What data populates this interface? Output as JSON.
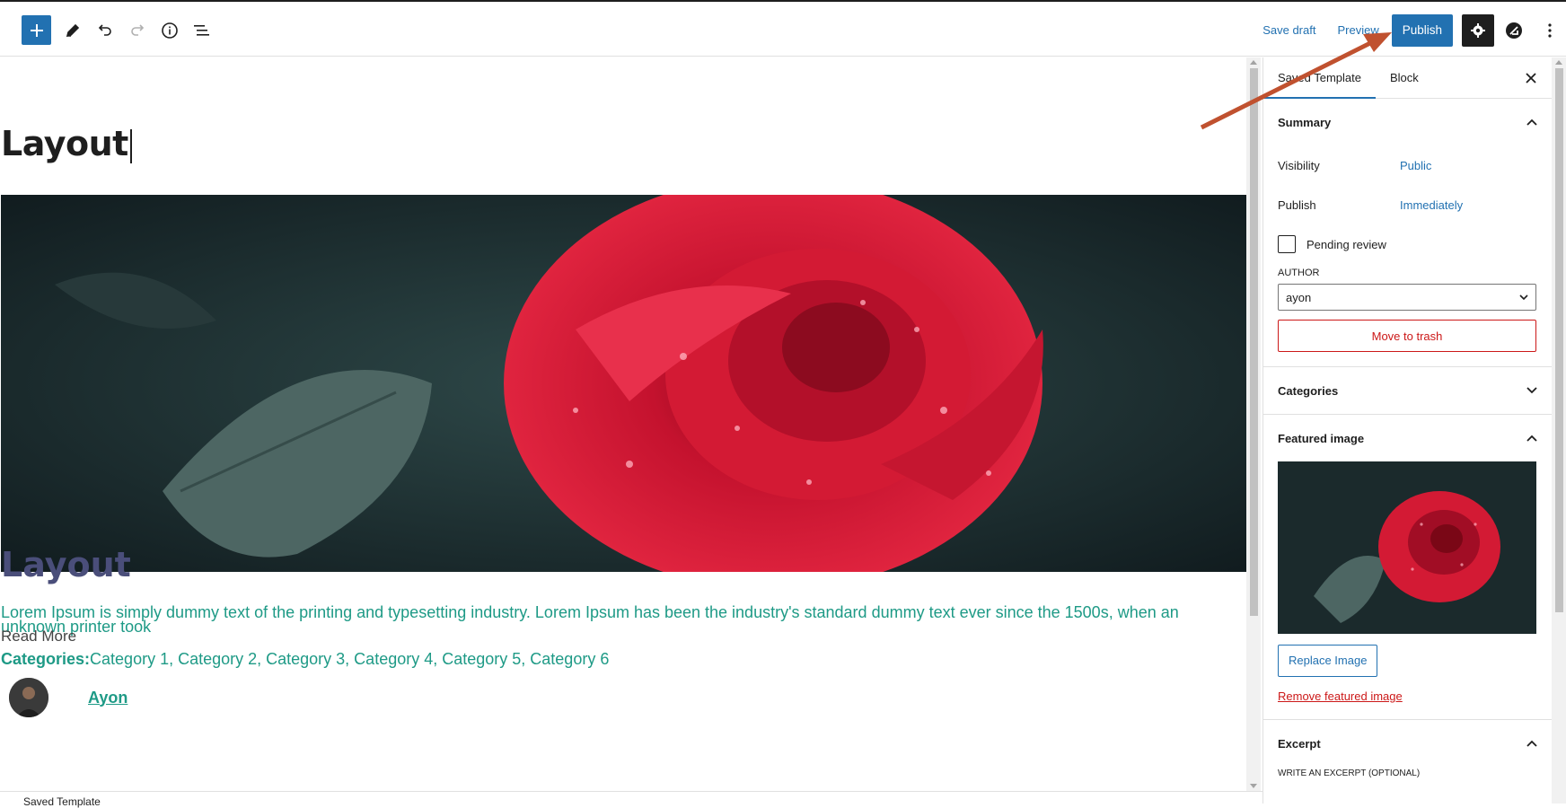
{
  "toolbar": {
    "save_draft": "Save draft",
    "preview": "Preview",
    "publish": "Publish",
    "icons": [
      "plus-icon",
      "pencil-icon",
      "undo-icon",
      "redo-icon",
      "info-icon",
      "list-view-icon",
      "gear-icon",
      "plugin-icon",
      "more-vertical-icon"
    ]
  },
  "editor": {
    "post_title": "Layout",
    "heading": "Layout",
    "excerpt": "Lorem Ipsum is simply dummy text of the printing and typesetting industry. Lorem Ipsum has been the industry's standard dummy text ever since the 1500s, when an unknown printer took",
    "read_more": "Read More",
    "categories_label": "Categories:",
    "categories_list": "Category 1, Category 2, Category 3, Category 4, Category 5, Category 6",
    "author": "Ayon"
  },
  "footer": {
    "breadcrumb": "Saved Template"
  },
  "sidebar": {
    "tabs": [
      "Saved Template",
      "Block"
    ],
    "summary": {
      "title": "Summary",
      "visibility_label": "Visibility",
      "visibility_value": "Public",
      "publish_label": "Publish",
      "publish_value": "Immediately",
      "pending_review": "Pending review",
      "author_label": "AUTHOR",
      "author_value": "ayon",
      "trash": "Move to trash"
    },
    "categories": {
      "title": "Categories"
    },
    "featured_image": {
      "title": "Featured image",
      "replace": "Replace Image",
      "remove": "Remove featured image"
    },
    "excerpt": {
      "title": "Excerpt",
      "sub": "WRITE AN EXCERPT (OPTIONAL)"
    }
  },
  "colors": {
    "accent": "#2271b1",
    "danger": "#cc1818",
    "teal_text": "#1e9a86",
    "heading_purple": "#4a4e7a",
    "annotation_arrow": "#c0512f"
  }
}
